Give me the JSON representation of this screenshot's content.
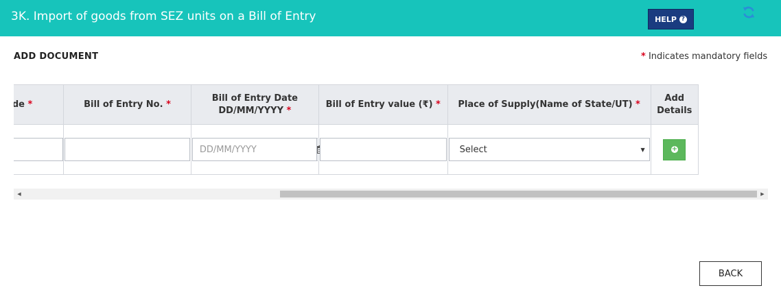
{
  "header": {
    "title": "3K. Import of goods from SEZ units on a Bill of Entry",
    "help_label": "HELP",
    "help_icon": "question-circle-icon",
    "refresh_icon": "refresh-icon"
  },
  "section": {
    "title": "ADD DOCUMENT",
    "mandatory_star": "*",
    "mandatory_note": "Indicates mandatory fields"
  },
  "table": {
    "headers": [
      {
        "label": "Port Code",
        "required": true
      },
      {
        "label": "Bill of Entry No.",
        "required": true
      },
      {
        "label": "Bill of Entry Date",
        "label2": "DD/MM/YYYY",
        "required": true
      },
      {
        "label": "Bill of Entry value (₹)",
        "required": true
      },
      {
        "label": "Place of Supply(Name of State/UT)",
        "required": true
      },
      {
        "label": "Add Details",
        "required": false
      }
    ],
    "row": {
      "port_code": "",
      "boe_no": "",
      "boe_date_placeholder": "DD/MM/YYYY",
      "boe_value": "",
      "place_of_supply": "Select",
      "add_icon": "plus-circle-icon"
    }
  },
  "footer": {
    "back_label": "BACK"
  },
  "colors": {
    "header_bg": "#17c4bb",
    "help_bg": "#1a3c80",
    "add_button": "#5cb85c",
    "required_star": "#d9001b"
  }
}
